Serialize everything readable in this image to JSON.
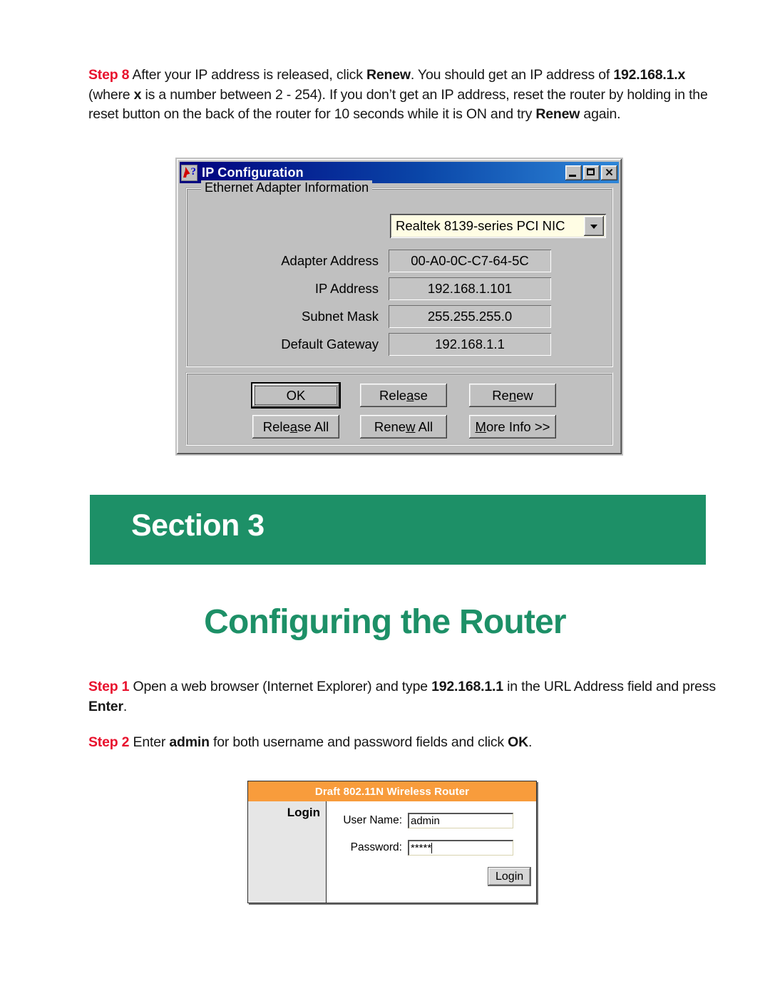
{
  "document": {
    "steps": {
      "step8": {
        "label": "Step 8",
        "text_parts": [
          {
            "t": " After your IP address is released, click ",
            "bold": false
          },
          {
            "t": "Renew",
            "bold": true
          },
          {
            "t": ". You should get an IP address of ",
            "bold": false
          },
          {
            "t": "192.168.1.x",
            "bold": true
          },
          {
            "t": " (where ",
            "bold": false
          },
          {
            "t": "x",
            "bold": true
          },
          {
            "t": " is a number between 2 - 254). If you don’t get an IP address, reset the router by holding in the reset button on the back of the router for 10 seconds while it is ON and try ",
            "bold": false
          },
          {
            "t": "Renew",
            "bold": true
          },
          {
            "t": " again.",
            "bold": false
          }
        ],
        "full_text": "Step 8 After your IP address is released, click Renew. You should get an IP address of 192.168.1.x (where x is a number between 2 - 254). If you don’t get an IP address, reset the router by holding in the reset button on the back of the router for 10 seconds while it is ON and try Renew again."
      },
      "step1": {
        "label": "Step 1",
        "full_text": "Step 1 Open a web browser (Internet Explorer) and type 192.168.1.1 in the URL Address field and press Enter."
      },
      "step2": {
        "label": "Step 2",
        "full_text": "Step 2 Enter admin for both username and password fields and click OK."
      }
    },
    "section_banner": {
      "label": "Section 3",
      "background_color": "#1d9067"
    },
    "page_heading": {
      "text": "Configuring the Router",
      "color": "#1d9067"
    }
  },
  "ip_config_dialog": {
    "title": "IP Configuration",
    "icon": "ip-config-icon",
    "window_buttons": {
      "minimize": "_",
      "maximize": "□",
      "close": "✕"
    },
    "group_box": {
      "legend": "Ethernet  Adapter Information",
      "adapter_select": {
        "selected": "Realtek 8139-series PCI NIC",
        "options": [
          "Realtek 8139-series PCI NIC"
        ]
      },
      "fields": [
        {
          "label": "Adapter Address",
          "value": "00-A0-0C-C7-64-5C"
        },
        {
          "label": "IP Address",
          "value": "192.168.1.101"
        },
        {
          "label": "Subnet Mask",
          "value": "255.255.255.0"
        },
        {
          "label": "Default Gateway",
          "value": "192.168.1.1"
        }
      ]
    },
    "buttons": [
      {
        "id": "ok",
        "label": "OK",
        "accel": "",
        "default": true
      },
      {
        "id": "release",
        "label_pre": "Rele",
        "accel": "a",
        "label_post": "se"
      },
      {
        "id": "renew",
        "label_pre": "Re",
        "accel": "n",
        "label_post": "ew"
      },
      {
        "id": "release_all",
        "label_pre": "Rele",
        "accel": "a",
        "label_post": "se All"
      },
      {
        "id": "renew_all",
        "label_pre": "Rene",
        "accel": "w",
        "label_post": " All"
      },
      {
        "id": "more_info",
        "label_pre": "",
        "accel": "M",
        "label_post": "ore Info >>"
      }
    ]
  },
  "router_login": {
    "header_title": "Draft 802.11N Wireless Router",
    "header_color": "#f89c3c",
    "sidebar_title": "Login",
    "fields": [
      {
        "label": "User Name:",
        "value": "admin"
      },
      {
        "label": "Password:",
        "value": "*****"
      }
    ],
    "submit_label": "Login"
  }
}
